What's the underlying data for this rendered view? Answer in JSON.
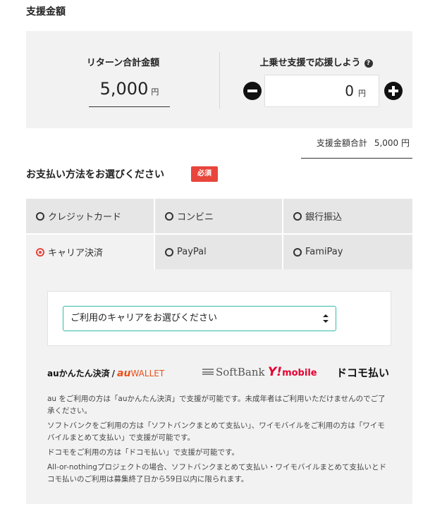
{
  "header": {
    "title": "支援金額"
  },
  "return_total": {
    "label": "リターン合計金額",
    "amount": "5,000",
    "unit": "円"
  },
  "extra_support": {
    "label": "上乗せ支援で応援しよう",
    "help_icon": "?",
    "value": "0",
    "unit": "円"
  },
  "total": {
    "label": "支援金額合計",
    "value": "5,000 円"
  },
  "payment": {
    "title": "お支払い方法をお選びください",
    "required_badge": "必須",
    "methods": [
      {
        "label": "クレジットカード",
        "selected": false
      },
      {
        "label": "コンビニ",
        "selected": false
      },
      {
        "label": "銀行振込",
        "selected": false
      },
      {
        "label": "キャリア決済",
        "selected": true
      },
      {
        "label": "PayPal",
        "selected": false
      },
      {
        "label": "FamiPay",
        "selected": false
      }
    ],
    "carrier_select": {
      "value": "ご利用のキャリアをお選びください"
    }
  },
  "logos": {
    "au_pay": "auかんたん決済",
    "au_slash": "/",
    "au_brand": "au",
    "au_wallet": "WALLET",
    "softbank": "SoftBank",
    "ymobile_y": "Y!",
    "ymobile": "mobile",
    "docomo": "ドコモ払い"
  },
  "notes": [
    "au をご利用の方は「auかんたん決済」で支援が可能です。未成年者はご利用いただけませんのでご了承ください。",
    "ソフトバンクをご利用の方は「ソフトバンクまとめて支払い」、ワイモバイルをご利用の方は「ワイモバイルまとめて支払い」で支援が可能です。",
    "ドコモをご利用の方は「ドコモ払い」で支援が可能です。",
    "All-or-nothingプロジェクトの場合、ソフトバンクまとめて支払い・ワイモバイルまとめて支払いとドコモ払いのご利用は募集終了日から59日以内に限られます。"
  ],
  "colors": {
    "accent_red": "#e8453c",
    "select_border": "#33bbaa",
    "panel_bg": "#f2f2f2"
  }
}
